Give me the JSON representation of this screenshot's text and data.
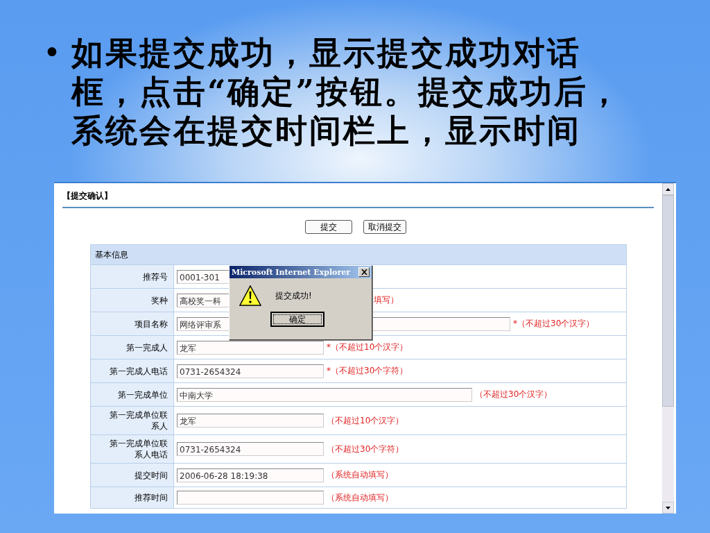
{
  "slide": {
    "bullet": "•",
    "text": "如果提交成功，显示提交成功对话框，点击“确定”按钮。提交成功后，系统会在提交时间栏上，显示时间"
  },
  "page": {
    "heading": "【提交确认】",
    "buttons": [
      "提交",
      "取消提交"
    ],
    "section_title": "基本信息",
    "rows": [
      {
        "label": "推荐号",
        "value": "0001-301",
        "kind": "short"
      },
      {
        "label": "奖种",
        "value": "高校奖一科",
        "kind": "covered",
        "hint": "填写）"
      },
      {
        "label": "项目名称",
        "value": "网络评审系",
        "kind": "long",
        "hint": "*（不超过30个汉字）"
      },
      {
        "label": "第一完成人",
        "value": "龙军",
        "kind": "short",
        "hint": "*（不超过10个汉字）"
      },
      {
        "label": "第一完成人电话",
        "value": "0731-2654324",
        "kind": "short",
        "hint": "*（不超过30个字符）"
      },
      {
        "label": "第一完成单位",
        "value": "中南大学",
        "kind": "medium",
        "hint": "（不超过30个汉字）"
      },
      {
        "label": "第一完成单位联系人",
        "value": "龙军",
        "kind": "short",
        "hint": "（不超过10个汉字）"
      },
      {
        "label": "第一完成单位联系人电话",
        "value": "0731-2654324",
        "kind": "short",
        "hint": "（不超过30个字符）"
      },
      {
        "label": "提交时间",
        "value": "2006-06-28 18:19:38",
        "kind": "short",
        "hint": "（系统自动填写）"
      },
      {
        "label": "推荐时间",
        "kind": "short",
        "hint": "（系统自动填写）"
      }
    ]
  },
  "dialog": {
    "title": "Microsoft Internet Explorer",
    "message": "提交成功!",
    "ok_button": "确定"
  }
}
